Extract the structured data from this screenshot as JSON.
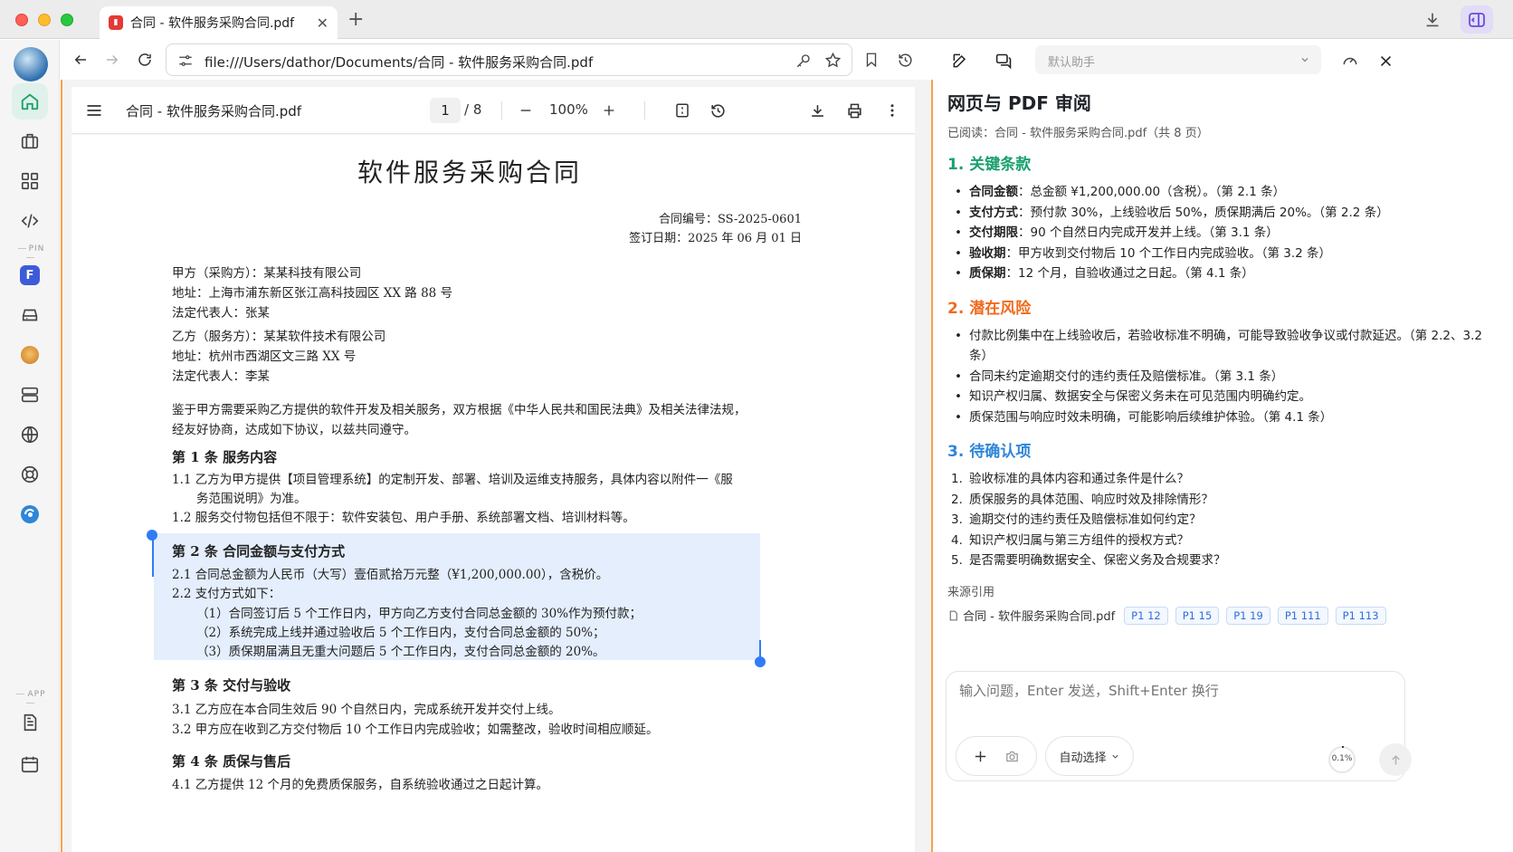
{
  "tab": {
    "title": "合同 - 软件服务采购合同.pdf"
  },
  "address": {
    "url": "file:///Users/dathor/Documents/合同 - 软件服务采购合同.pdf"
  },
  "rail": {
    "pin_label": "PIN",
    "app_label": "APP",
    "f_badge": "F"
  },
  "pdf_toolbar": {
    "title": "合同 - 软件服务采购合同.pdf",
    "page": "1",
    "page_total": "/ 8",
    "zoom": "100%"
  },
  "document": {
    "title": "软件服务采购合同",
    "contract_no": "合同编号：SS-2025-0601",
    "sign_date": "签订日期：2025 年 06 月 01 日",
    "party_a": [
      "甲方（采购方）：某某科技有限公司",
      "地址：上海市浦东新区张江高科技园区 XX 路 88 号",
      "法定代表人：张某"
    ],
    "party_b": [
      "乙方（服务方）：某某软件技术有限公司",
      "地址：杭州市西湖区文三路 XX 号",
      "法定代表人：李某"
    ],
    "preamble": [
      "鉴于甲方需要采购乙方提供的软件开发及相关服务，双方根据《中华人民共和国民法典》及相关法律法规，",
      "经友好协商，达成如下协议，以兹共同遵守。"
    ],
    "a1_title": "第 1 条  服务内容",
    "a1_lines": [
      "1.1  乙方为甲方提供【项目管理系统】的定制开发、部署、培训及运维支持服务，具体内容以附件一《服",
      "务范围说明》为准。",
      "1.2  服务交付物包括但不限于：软件安装包、用户手册、系统部署文档、培训材料等。"
    ],
    "a2_title": "第 2 条  合同金额与支付方式",
    "a2_lines": [
      "2.1  合同总金额为人民币（大写）壹佰贰拾万元整（¥1,200,000.00），含税价。",
      "2.2  支付方式如下：",
      "（1）合同签订后 5 个工作日内，甲方向乙方支付合同总金额的 30%作为预付款；",
      "（2）系统完成上线并通过验收后 5 个工作日内，支付合同总金额的 50%；",
      "（3）质保期届满且无重大问题后 5 个工作日内，支付合同总金额的 20%。"
    ],
    "a3_title": "第 3 条  交付与验收",
    "a3_lines": [
      "3.1  乙方应在本合同生效后 90 个自然日内，完成系统开发并交付上线。",
      "3.2  甲方应在收到乙方交付物后 10 个工作日内完成验收；如需整改，验收时间相应顺延。"
    ],
    "a4_title": "第 4 条  质保与售后",
    "a4_lines": [
      "4.1  乙方提供 12 个月的免费质保服务，自系统验收通过之日起计算。"
    ]
  },
  "assistant": {
    "selector_placeholder": "默认助手",
    "heading": "网页与 PDF 审阅",
    "read_line": "已阅读：合同 - 软件服务采购合同.pdf（共 8 页）",
    "sec1": "1. 关键条款",
    "sec1_items": [
      {
        "bold": "合同金额",
        "text": "：总金额 ¥1,200,000.00（含税）。（第 2.1 条）"
      },
      {
        "bold": "支付方式",
        "text": "：预付款 30%，上线验收后 50%，质保期满后 20%。（第 2.2 条）"
      },
      {
        "bold": "交付期限",
        "text": "：90 个自然日内完成开发并上线。（第 3.1 条）"
      },
      {
        "bold": "验收期",
        "text": "：甲方收到交付物后 10 个工作日内完成验收。（第 3.2 条）"
      },
      {
        "bold": "质保期",
        "text": "：12 个月，自验收通过之日起。（第 4.1 条）"
      }
    ],
    "sec2": "2. 潜在风险",
    "sec2_items": [
      "付款比例集中在上线验收后，若验收标准不明确，可能导致验收争议或付款延迟。（第 2.2、3.2 条）",
      "合同未约定逾期交付的违约责任及赔偿标准。（第 3.1 条）",
      "知识产权归属、数据安全与保密义务未在可见范围内明确约定。",
      "质保范围与响应时效未明确，可能影响后续维护体验。（第 4.1 条）"
    ],
    "sec3": "3. 待确认项",
    "sec3_items": [
      "验收标准的具体内容和通过条件是什么？",
      "质保服务的具体范围、响应时效及排除情形？",
      "逾期交付的违约责任及赔偿标准如何约定？",
      "知识产权归属与第三方组件的授权方式？",
      "是否需要明确数据安全、保密义务及合规要求？"
    ],
    "refs_label": "来源引用",
    "ref_file": "合同 - 软件服务采购合同.pdf",
    "ref_chips": [
      "P1 12",
      "P1 15",
      "P1 19",
      "P1 111",
      "P1 113"
    ],
    "composer_placeholder": "输入问题，Enter 发送，Shift+Enter 换行",
    "model_select": "自动选择",
    "context_usage": "0.1%"
  },
  "colors": {
    "accent_green": "#1aa06d",
    "accent_orange": "#f06a1d",
    "accent_blue": "#2f86d8",
    "selection": "#e4eefc"
  }
}
